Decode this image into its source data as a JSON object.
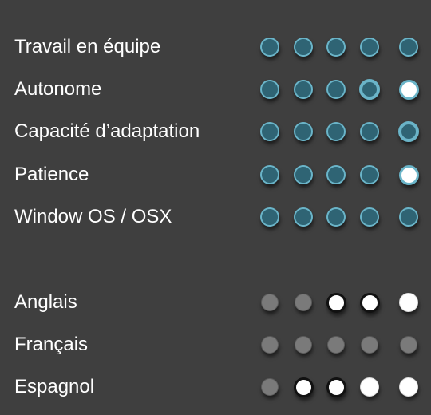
{
  "skills": [
    {
      "label": "Travail en équipe",
      "dots": [
        "teal",
        "teal",
        "teal",
        "teal",
        "teal"
      ]
    },
    {
      "label": "Autonome",
      "dots": [
        "teal",
        "teal",
        "teal",
        "teal-thick",
        "white-ring"
      ]
    },
    {
      "label": "Capacité d’adaptation",
      "dots": [
        "teal",
        "teal",
        "teal",
        "teal",
        "teal-thick"
      ]
    },
    {
      "label": "Patience",
      "dots": [
        "teal",
        "teal",
        "teal",
        "teal",
        "white-ring"
      ]
    },
    {
      "label": "Window OS / OSX",
      "dots": [
        "teal",
        "teal",
        "teal",
        "teal",
        "teal"
      ]
    }
  ],
  "languages": [
    {
      "label": "Anglais",
      "dots": [
        "gray",
        "gray",
        "white-black",
        "white-black",
        "white"
      ]
    },
    {
      "label": "Français",
      "dots": [
        "gray",
        "gray",
        "gray",
        "gray",
        "gray"
      ]
    },
    {
      "label": "Espagnol",
      "dots": [
        "gray",
        "white-black",
        "white-black",
        "white",
        "white"
      ]
    }
  ],
  "colors": {
    "background": "#3f3f3f",
    "teal_fill": "#2f6474",
    "teal_border": "#6ab4c8",
    "gray_fill": "#7a7a7a",
    "white": "#ffffff"
  }
}
